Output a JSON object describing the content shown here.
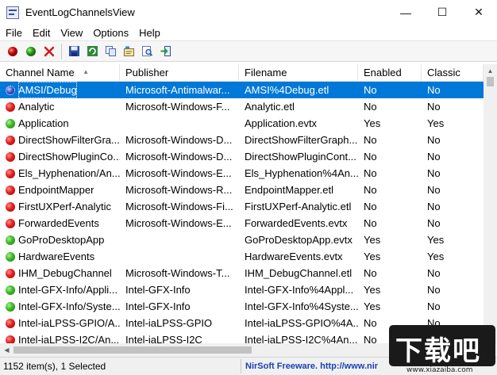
{
  "window": {
    "title": "EventLogChannelsView",
    "controls": {
      "minimize": "—",
      "maximize": "☐",
      "close": "✕"
    }
  },
  "menu": [
    "File",
    "Edit",
    "View",
    "Options",
    "Help"
  ],
  "toolbar": {
    "icons": [
      "enable-icon",
      "disable-icon",
      "clear-icon",
      "save-icon",
      "refresh-icon",
      "copy-icon",
      "properties-icon",
      "find-icon",
      "exit-icon"
    ]
  },
  "columns": [
    "Channel Name",
    "Publisher",
    "Filename",
    "Enabled",
    "Classic"
  ],
  "rows": [
    {
      "status": "blue",
      "name": "AMSI/Debug",
      "publisher": "Microsoft-Antimalwar...",
      "filename": "AMSI%4Debug.etl",
      "enabled": "No",
      "classic": "No",
      "selected": true
    },
    {
      "status": "red",
      "name": "Analytic",
      "publisher": "Microsoft-Windows-F...",
      "filename": "Analytic.etl",
      "enabled": "No",
      "classic": "No"
    },
    {
      "status": "green",
      "name": "Application",
      "publisher": "",
      "filename": "Application.evtx",
      "enabled": "Yes",
      "classic": "Yes"
    },
    {
      "status": "red",
      "name": "DirectShowFilterGra...",
      "publisher": "Microsoft-Windows-D...",
      "filename": "DirectShowFilterGraph...",
      "enabled": "No",
      "classic": "No"
    },
    {
      "status": "red",
      "name": "DirectShowPluginCo...",
      "publisher": "Microsoft-Windows-D...",
      "filename": "DirectShowPluginCont...",
      "enabled": "No",
      "classic": "No"
    },
    {
      "status": "red",
      "name": "Els_Hyphenation/An...",
      "publisher": "Microsoft-Windows-E...",
      "filename": "Els_Hyphenation%4An...",
      "enabled": "No",
      "classic": "No"
    },
    {
      "status": "red",
      "name": "EndpointMapper",
      "publisher": "Microsoft-Windows-R...",
      "filename": "EndpointMapper.etl",
      "enabled": "No",
      "classic": "No"
    },
    {
      "status": "red",
      "name": "FirstUXPerf-Analytic",
      "publisher": "Microsoft-Windows-Fi...",
      "filename": "FirstUXPerf-Analytic.etl",
      "enabled": "No",
      "classic": "No"
    },
    {
      "status": "red",
      "name": "ForwardedEvents",
      "publisher": "Microsoft-Windows-E...",
      "filename": "ForwardedEvents.evtx",
      "enabled": "No",
      "classic": "No"
    },
    {
      "status": "green",
      "name": "GoProDesktopApp",
      "publisher": "",
      "filename": "GoProDesktopApp.evtx",
      "enabled": "Yes",
      "classic": "Yes"
    },
    {
      "status": "green",
      "name": "HardwareEvents",
      "publisher": "",
      "filename": "HardwareEvents.evtx",
      "enabled": "Yes",
      "classic": "Yes"
    },
    {
      "status": "red",
      "name": "IHM_DebugChannel",
      "publisher": "Microsoft-Windows-T...",
      "filename": "IHM_DebugChannel.etl",
      "enabled": "No",
      "classic": "No"
    },
    {
      "status": "green",
      "name": "Intel-GFX-Info/Appli...",
      "publisher": "Intel-GFX-Info",
      "filename": "Intel-GFX-Info%4Appl...",
      "enabled": "Yes",
      "classic": "No"
    },
    {
      "status": "green",
      "name": "Intel-GFX-Info/Syste...",
      "publisher": "Intel-GFX-Info",
      "filename": "Intel-GFX-Info%4Syste...",
      "enabled": "Yes",
      "classic": "No"
    },
    {
      "status": "red",
      "name": "Intel-iaLPSS-GPIO/A...",
      "publisher": "Intel-iaLPSS-GPIO",
      "filename": "Intel-iaLPSS-GPIO%4A...",
      "enabled": "No",
      "classic": "No"
    },
    {
      "status": "red",
      "name": "Intel-iaLPSS-I2C/An...",
      "publisher": "Intel-iaLPSS-I2C",
      "filename": "Intel-iaLPSS-I2C%4An...",
      "enabled": "No",
      "classic": "No"
    }
  ],
  "status": {
    "count": "1152 item(s), 1 Selected",
    "link": "NirSoft Freeware.  http://www.nir"
  },
  "watermark": {
    "text": "下载吧",
    "url": "www.xiazaiba.com"
  },
  "colors": {
    "selection": "#0078d7",
    "link": "#1a3fb5"
  }
}
